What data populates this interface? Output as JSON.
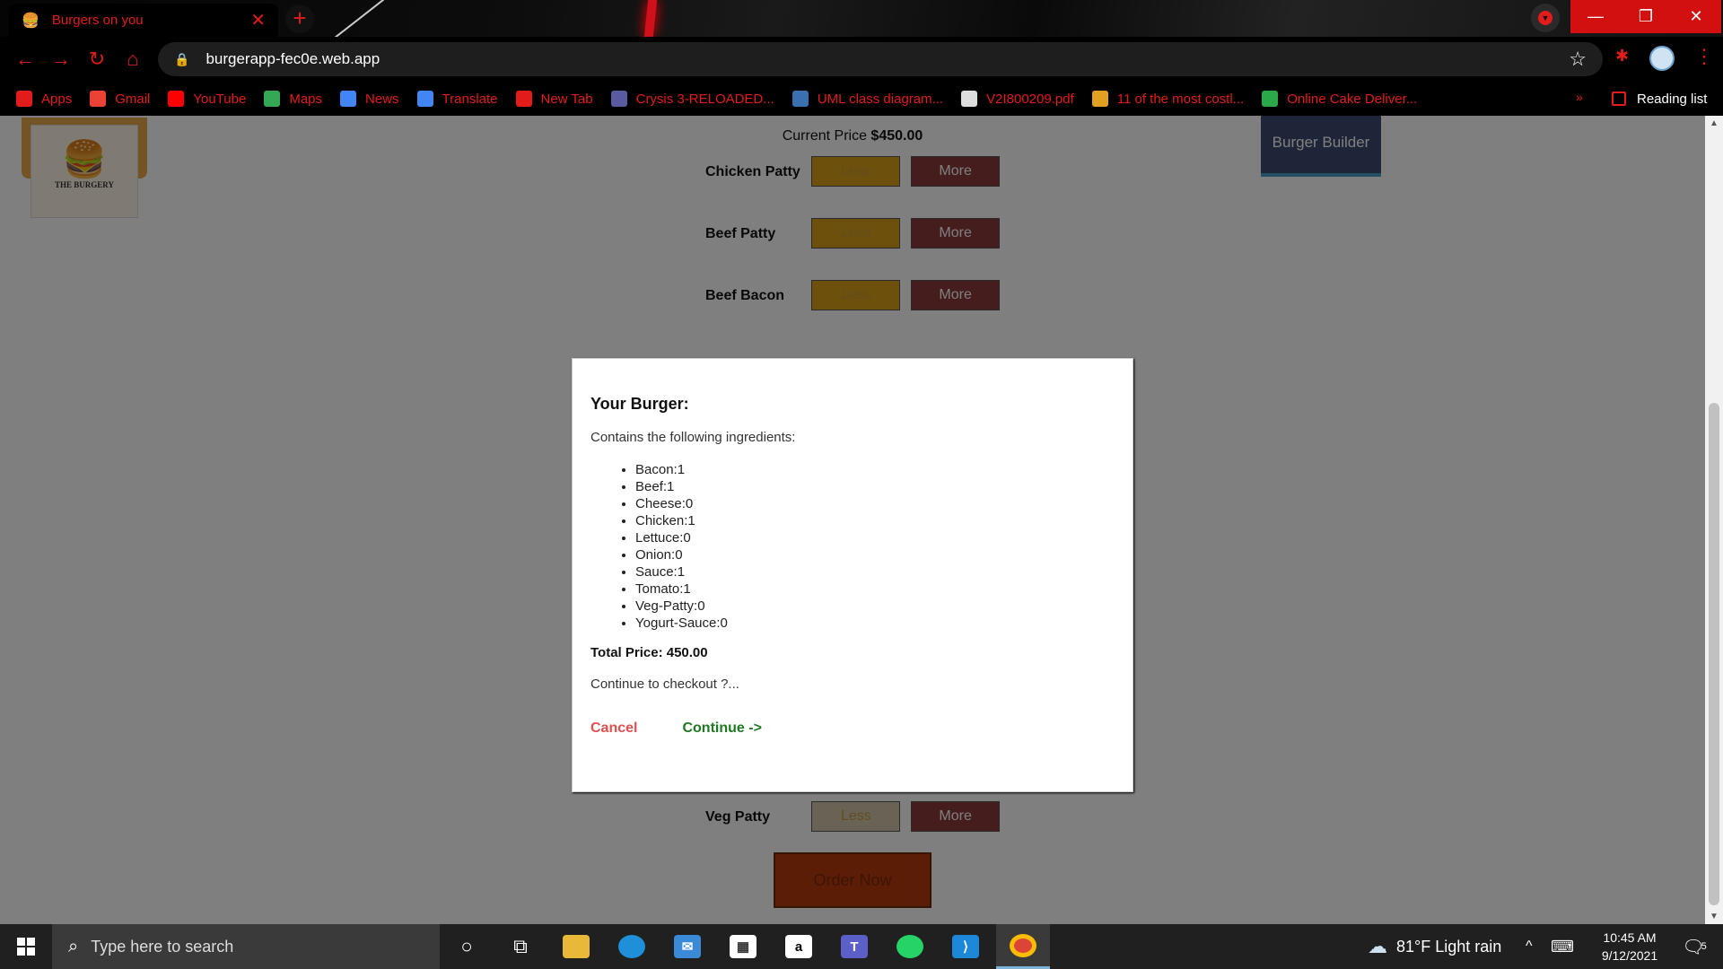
{
  "browser": {
    "tab_title": "Burgers on you",
    "tab_icon": "burger-emoji",
    "url": "burgerapp-fec0e.web.app",
    "bookmarks": [
      {
        "label": "Apps",
        "icon": "apps-grid-icon",
        "color": "#e21b1b"
      },
      {
        "label": "Gmail",
        "icon": "gmail-icon",
        "color": "#ea4335"
      },
      {
        "label": "YouTube",
        "icon": "youtube-icon",
        "color": "#ff0000"
      },
      {
        "label": "Maps",
        "icon": "maps-icon",
        "color": "#34a853"
      },
      {
        "label": "News",
        "icon": "news-icon",
        "color": "#4285f4"
      },
      {
        "label": "Translate",
        "icon": "translate-icon",
        "color": "#4285f4"
      },
      {
        "label": "New Tab",
        "icon": "newtab-icon",
        "color": "#e21b1b"
      },
      {
        "label": "Crysis 3-RELOADED...",
        "icon": "site-icon",
        "color": "#5a5aa0"
      },
      {
        "label": "UML class diagram...",
        "icon": "site-icon",
        "color": "#3a70b0"
      },
      {
        "label": "V2I800209.pdf",
        "icon": "pdf-icon",
        "color": "#dddddd"
      },
      {
        "label": "11 of the most costl...",
        "icon": "site-icon",
        "color": "#e0a020"
      },
      {
        "label": "Online Cake Deliver...",
        "icon": "site-icon",
        "color": "#2aa84a"
      }
    ],
    "reading_list": "Reading list"
  },
  "page": {
    "current_price_label": "Current Price",
    "current_price_value": "$450.00",
    "nav_item": "Burger Builder",
    "logo_text": "THE BURGERY",
    "controls": [
      {
        "label": "Chicken Patty",
        "less": "Less",
        "more": "More"
      },
      {
        "label": "Beef Patty",
        "less": "Less",
        "more": "More"
      },
      {
        "label": "Beef Bacon",
        "less": "Less",
        "more": "More"
      },
      {
        "label": "Veg Patty",
        "less": "Less",
        "more": "More"
      }
    ],
    "order_button": "Order Now"
  },
  "modal": {
    "title": "Your Burger:",
    "subtitle": "Contains the following ingredients:",
    "ingredients": [
      "Bacon:1",
      "Beef:1",
      "Cheese:0",
      "Chicken:1",
      "Lettuce:0",
      "Onion:0",
      "Sauce:1",
      "Tomato:1",
      "Veg-Patty:0",
      "Yogurt-Sauce:0"
    ],
    "total": "Total Price: 450.00",
    "continue_prompt": "Continue to checkout ?...",
    "cancel": "Cancel",
    "continue": "Continue ->"
  },
  "taskbar": {
    "search_placeholder": "Type here to search",
    "weather": "81°F  Light rain",
    "time": "10:45 AM",
    "date": "9/12/2021",
    "notifications": "5"
  },
  "colors": {
    "accent_red": "#e21b1b",
    "less_button": "#d8a018",
    "more_button": "#8b3a3a",
    "nav_bg": "#3d4a72",
    "cancel": "#e05050",
    "continue": "#1e7a20"
  }
}
